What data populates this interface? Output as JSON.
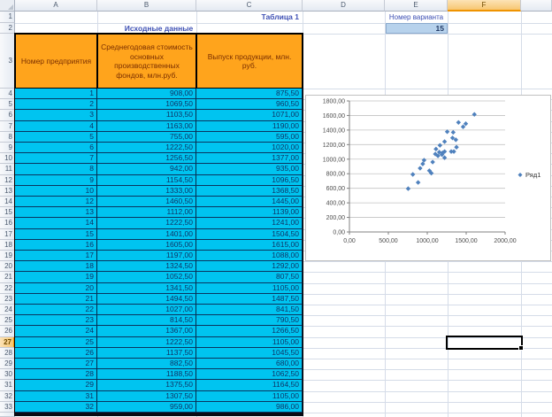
{
  "labels": {
    "table_caption": "Таблица 1",
    "data_title": "Исходные данные",
    "variant_label": "Номер варианта",
    "variant_value": "15"
  },
  "grid": {
    "column_letters": [
      "A",
      "B",
      "C",
      "D",
      "E",
      "F",
      ""
    ],
    "highlighted_column": "F",
    "highlighted_row": "27",
    "selected_cell": "F27",
    "first_row": 1,
    "last_row": 33
  },
  "table": {
    "col_headers": [
      "Номер предприятия",
      "Среднегодовая стоимость основных производственных фондов, млн.руб.",
      "Выпуск продукции, млн. руб."
    ],
    "rows": [
      [
        "1",
        "908,00",
        "875,50"
      ],
      [
        "2",
        "1069,50",
        "960,50"
      ],
      [
        "3",
        "1103,50",
        "1071,00"
      ],
      [
        "4",
        "1163,00",
        "1190,00"
      ],
      [
        "5",
        "755,00",
        "595,00"
      ],
      [
        "6",
        "1222,50",
        "1020,00"
      ],
      [
        "7",
        "1256,50",
        "1377,00"
      ],
      [
        "8",
        "942,00",
        "935,00"
      ],
      [
        "9",
        "1154,50",
        "1096,50"
      ],
      [
        "10",
        "1333,00",
        "1368,50"
      ],
      [
        "12",
        "1460,50",
        "1445,00"
      ],
      [
        "13",
        "1112,00",
        "1139,00"
      ],
      [
        "14",
        "1222,50",
        "1241,00"
      ],
      [
        "15",
        "1401,00",
        "1504,50"
      ],
      [
        "16",
        "1605,00",
        "1615,00"
      ],
      [
        "17",
        "1197,00",
        "1088,00"
      ],
      [
        "18",
        "1324,50",
        "1292,00"
      ],
      [
        "19",
        "1052,50",
        "807,50"
      ],
      [
        "20",
        "1341,50",
        "1105,00"
      ],
      [
        "21",
        "1494,50",
        "1487,50"
      ],
      [
        "22",
        "1027,00",
        "841,50"
      ],
      [
        "23",
        "814,50",
        "790,50"
      ],
      [
        "24",
        "1367,00",
        "1266,50"
      ],
      [
        "25",
        "1222,50",
        "1105,00"
      ],
      [
        "26",
        "1137,50",
        "1045,50"
      ],
      [
        "27",
        "882,50",
        "680,00"
      ],
      [
        "28",
        "1188,50",
        "1062,50"
      ],
      [
        "29",
        "1375,50",
        "1164,50"
      ],
      [
        "31",
        "1307,50",
        "1105,00"
      ],
      [
        "32",
        "959,00",
        "986,00"
      ]
    ]
  },
  "chart_data": {
    "type": "scatter",
    "series": [
      {
        "name": "Ряд1",
        "marker": "diamond",
        "color": "#4F81BD",
        "points": [
          [
            908,
            875.5
          ],
          [
            1069.5,
            960.5
          ],
          [
            1103.5,
            1071
          ],
          [
            1163,
            1190
          ],
          [
            755,
            595
          ],
          [
            1222.5,
            1020
          ],
          [
            1256.5,
            1377
          ],
          [
            942,
            935
          ],
          [
            1154.5,
            1096.5
          ],
          [
            1333,
            1368.5
          ],
          [
            1460.5,
            1445
          ],
          [
            1112,
            1139
          ],
          [
            1222.5,
            1241
          ],
          [
            1401,
            1504.5
          ],
          [
            1605,
            1615
          ],
          [
            1197,
            1088
          ],
          [
            1324.5,
            1292
          ],
          [
            1052.5,
            807.5
          ],
          [
            1341.5,
            1105
          ],
          [
            1494.5,
            1487.5
          ],
          [
            1027,
            841.5
          ],
          [
            814.5,
            790.5
          ],
          [
            1367,
            1266.5
          ],
          [
            1222.5,
            1105
          ],
          [
            1137.5,
            1045.5
          ],
          [
            882.5,
            680
          ],
          [
            1188.5,
            1062.5
          ],
          [
            1375.5,
            1164.5
          ],
          [
            1307.5,
            1105
          ],
          [
            959,
            986
          ]
        ]
      }
    ],
    "xlim": [
      0,
      2000
    ],
    "ylim": [
      0,
      1800
    ],
    "x_ticks": [
      0,
      500,
      1000,
      1500,
      2000
    ],
    "y_tick_step": 200,
    "tick_format": "#,##0.00 comma-decimal",
    "grid": true,
    "legend_position": "right"
  },
  "colors": {
    "table_header_fill": "#FFA41C",
    "table_header_text": "#7B2F00",
    "data_fill": "#00C4F0",
    "data_text": "#0E3466",
    "accent_text": "#3E50B4",
    "variant_cell_fill": "#B7D2EC",
    "marker": "#4F81BD",
    "gridline": "#D5DCE8"
  }
}
